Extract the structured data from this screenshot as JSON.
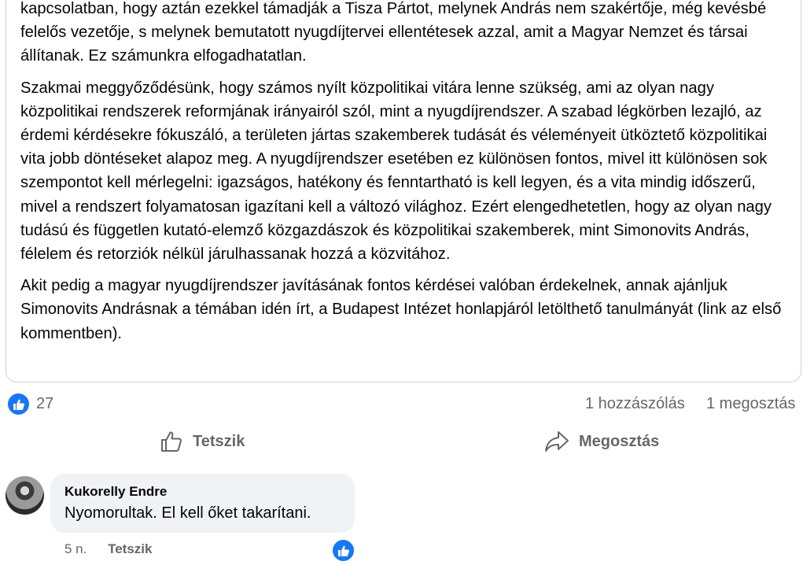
{
  "post": {
    "paragraphs": [
      "kapcsolatban, hogy aztán ezekkel támadják a Tisza Pártot, melynek András nem szakértője, még kevésbé felelős vezetője, s melynek bemutatott nyugdíjtervei ellentétesek azzal, amit a Magyar Nemzet és társai állítanak. Ez számunkra elfogadhatatlan.",
      "Szakmai meggyőződésünk, hogy számos nyílt közpolitikai vitára lenne szükség, ami az olyan nagy közpolitikai rendszerek reformjának irányairól szól, mint a nyugdíjrendszer. A szabad légkörben lezajló, az érdemi kérdésekre fókuszáló, a területen jártas szakemberek tudását és véleményeit ütköztető közpolitikai vita jobb döntéseket alapoz meg. A nyugdíjrendszer esetében ez különösen fontos, mivel itt különösen sok szempontot kell mérlegelni: igazságos, hatékony és fenntartható is kell legyen, és a vita mindig időszerű, mivel a rendszert folyamatosan igazítani kell a változó világhoz.  Ezért elengedhetetlen, hogy az olyan nagy tudású és független kutató-elemző közgazdászok és közpolitikai szakemberek, mint Simonovits András, félelem és retorziók nélkül járulhassanak hozzá a közvitához.",
      "Akit pedig a magyar nyugdíjrendszer javításának fontos kérdései valóban érdekelnek, annak ajánljuk Simonovits Andrásnak a témában idén írt, a Budapest Intézet honlapjáról letölthető tanulmányát (link az első kommentben)."
    ]
  },
  "stats": {
    "like_count": "27",
    "comments": "1 hozzászólás",
    "shares": "1 megosztás"
  },
  "actions": {
    "like_label": "Tetszik",
    "share_label": "Megosztás"
  },
  "comment": {
    "author": "Kukorelly Endre",
    "text": "Nyomorultak. El kell őket takarítani.",
    "time": "5 n.",
    "like_label": "Tetszik"
  },
  "colors": {
    "accent": "#1877f2",
    "muted_text": "#65676b",
    "bubble": "#f0f2f5"
  },
  "icons": [
    "like-icon",
    "thumbs-up-outline-icon",
    "share-arrow-icon"
  ]
}
